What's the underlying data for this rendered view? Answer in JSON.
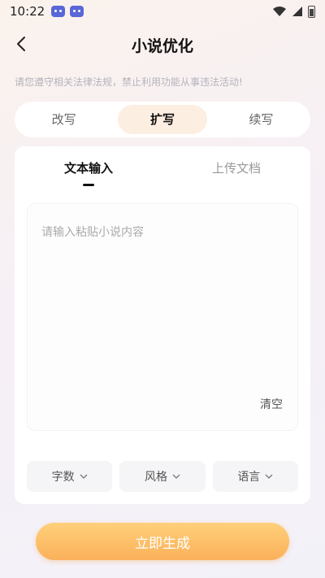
{
  "status": {
    "time": "10:22"
  },
  "header": {
    "title": "小说优化"
  },
  "notice": "请您遵守相关法律法规，禁止利用功能从事违法活动!",
  "mode_tabs": [
    {
      "label": "改写"
    },
    {
      "label": "扩写"
    },
    {
      "label": "续写"
    }
  ],
  "active_mode": "扩写",
  "input_tabs": [
    {
      "label": "文本输入"
    },
    {
      "label": "上传文档"
    }
  ],
  "editor": {
    "placeholder": "请输入粘贴小说内容",
    "clear_label": "清空"
  },
  "options": [
    {
      "label": "字数"
    },
    {
      "label": "风格"
    },
    {
      "label": "语言"
    }
  ],
  "generate_label": "立即生成",
  "colors": {
    "accent_start": "#ffd07a",
    "accent_end": "#fbb05a",
    "active_tab_bg": "#fdeee2"
  },
  "icons": [
    "back-arrow-icon",
    "wifi-icon",
    "signal-icon",
    "battery-icon",
    "chevron-down-icon",
    "game-controller-icon"
  ]
}
